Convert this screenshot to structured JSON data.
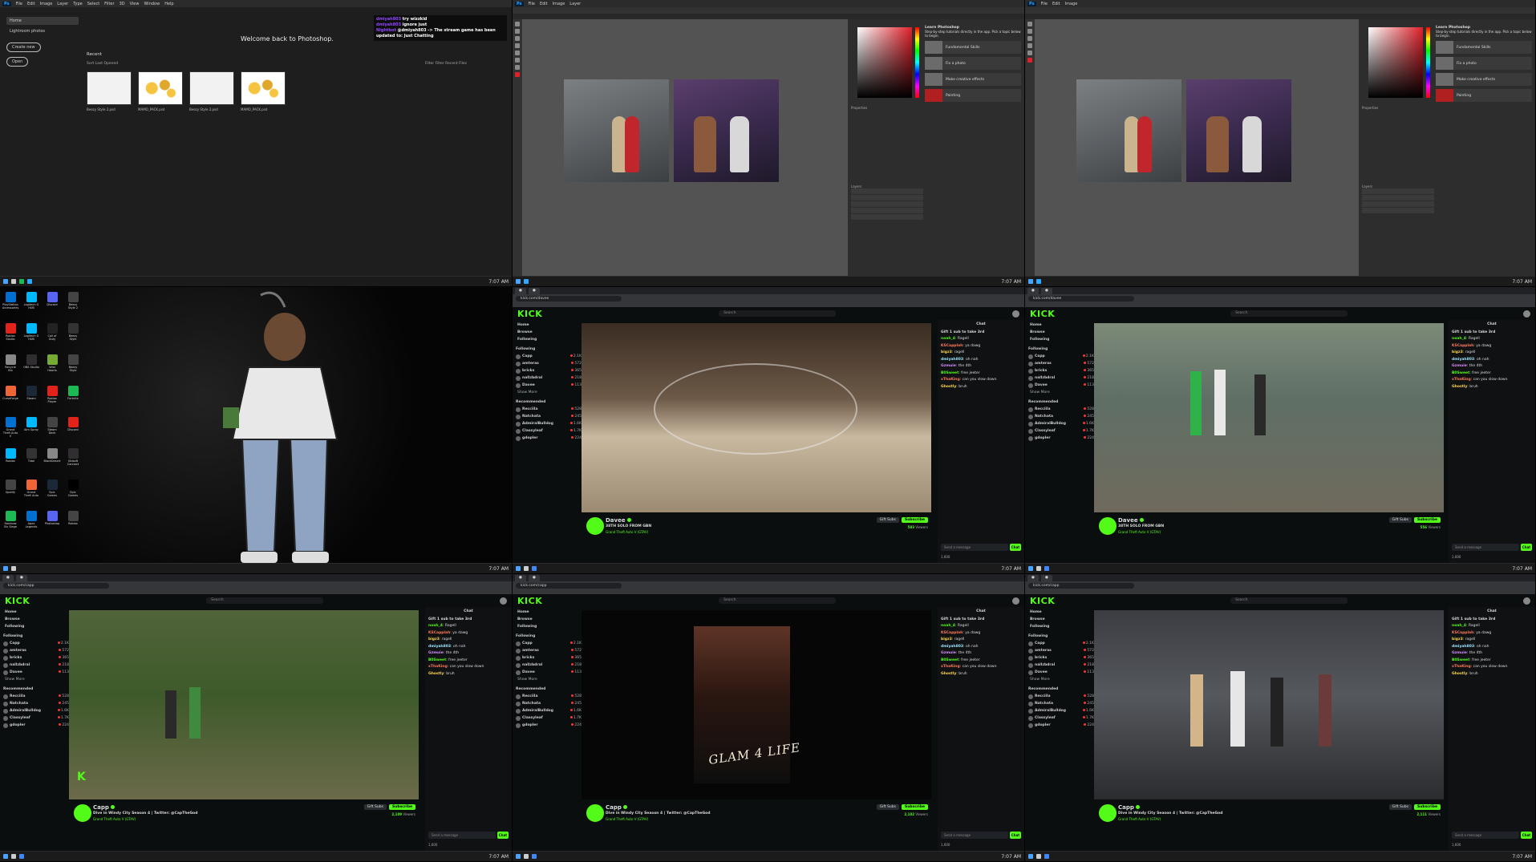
{
  "colors": {
    "kick_green": "#53fc18",
    "ps_blue": "#31a8ff",
    "twitch_purple": "#9147ff",
    "red_live": "#ff3333"
  },
  "taskbar": {
    "time": "7:07 AM"
  },
  "photoshop": {
    "app_short": "Ps",
    "menu": [
      "File",
      "Edit",
      "Image",
      "Layer",
      "Type",
      "Select",
      "Filter",
      "3D",
      "View",
      "Window",
      "Help"
    ],
    "home": {
      "nav": [
        "Home",
        "Lightroom photos"
      ],
      "create_new": "Create new",
      "open": "Open",
      "welcome": "Welcome back to Photoshop.",
      "recent": "Recent",
      "sort_label": "Sort",
      "sort_value": "Last Opened",
      "filter_label": "Filter",
      "filter_placeholder": "Filter Recent Files",
      "files": [
        {
          "name": "Beezy Style 2.psd",
          "style": "plain"
        },
        {
          "name": "MAMO_PACK.psd",
          "style": "coins"
        },
        {
          "name": "Beezy Style 2.psd",
          "style": "plain"
        },
        {
          "name": "MAMO_PACK.psd",
          "style": "coins"
        }
      ]
    },
    "editor": {
      "learn_title": "Learn Photoshop",
      "learn_sub": "Step-by-step tutorials directly in the app. Pick a topic below to begin.",
      "topics": [
        "Fundamental Skills",
        "Fix a photo",
        "Make creative effects",
        "Painting"
      ],
      "properties": "Properties",
      "layers": "Layers"
    }
  },
  "twitch_chat": [
    {
      "user": "dmiyah803",
      "text": "try wizzkid"
    },
    {
      "user": "dmiyah803",
      "text": "ignore just"
    },
    {
      "user": "Nightbot",
      "text": "@dmiyah803 -> The stream game has been updated to: Just Chatting"
    }
  ],
  "desktop": {
    "icons": [
      "PlayStation Accessories",
      "Logitech G HUB",
      "Discord",
      "Beezy Style 2",
      "Roblox Studio",
      "Logitech G HUB",
      "Call of Duty",
      "Beezy Style",
      "Recycle Bin",
      "OBS Studio",
      "Wild Hearts",
      "Beezy Style",
      "CurseForge",
      "Steam",
      "Roblox Player",
      "",
      "Fortnite",
      "Grand Theft Auto V",
      "Aim Spray",
      "",
      "Steam Deck",
      "Discord",
      "Roblox",
      "",
      "Tidal",
      "BlackDesert",
      "Ubisoft Connect",
      "",
      "Spotify",
      "Grand Theft Auto",
      "Epic Games",
      "",
      "Epic Games",
      "Rainbow Six Siege",
      "Apex Legends",
      "",
      "Photoshop",
      "Roblox",
      "",
      ""
    ]
  },
  "kick": {
    "logo": "KICK",
    "url": "kick.com/davee",
    "url2": "kick.com/capp",
    "search_placeholder": "Search",
    "nav": [
      "Home",
      "Browse",
      "Following"
    ],
    "following_header": "Following",
    "recommended_header": "Recommended",
    "show_more": "Show More",
    "following": [
      {
        "name": "Capp",
        "viewers": "2.1K"
      },
      {
        "name": "amteras",
        "viewers": "572"
      },
      {
        "name": "bricks",
        "viewers": "365"
      },
      {
        "name": "nallzbdral",
        "viewers": "218"
      },
      {
        "name": "Davee",
        "viewers": "113"
      }
    ],
    "recommended": [
      {
        "name": "Recciila",
        "viewers": "528"
      },
      {
        "name": "Natchata",
        "viewers": "245"
      },
      {
        "name": "AdmiralBulldog",
        "viewers": "1.6K"
      },
      {
        "name": "Classyleaf",
        "viewers": "1.7K"
      },
      {
        "name": "gdopler",
        "viewers": "224"
      }
    ],
    "chat_title": "Chat",
    "chat_pin": "Gift 1 sub to take 3rd",
    "chat_placeholder": "Send a message",
    "chat_button": "Chat",
    "chat_points": "1,600",
    "chat_messages": [
      {
        "user": "noah_4",
        "text": "Ragell"
      },
      {
        "user": "KSCapplah",
        "text": "ya dawg"
      },
      {
        "user": "bigz3",
        "text": "ragell"
      },
      {
        "user": "dmiyah803",
        "text": "oh nah"
      },
      {
        "user": "Gzmuie",
        "text": "the 4th"
      },
      {
        "user": "B0Sweet",
        "text": "free jeeter"
      },
      {
        "user": "xThaKing",
        "text": "can you slow down"
      },
      {
        "user": "Ghostly",
        "text": "bruh"
      }
    ],
    "streams": [
      {
        "streamer": "Davee",
        "title": "38TH SOLO FROM GBN",
        "category": "Grand Theft Auto V (GTAV)",
        "viewers": "583",
        "scene": "gta-basketball"
      },
      {
        "streamer": "Davee",
        "title": "38TH SOLO FROM GBN",
        "category": "Grand Theft Auto V (GTAV)",
        "viewers": "556",
        "scene": "gta-street"
      },
      {
        "streamer": "Capp",
        "title": "Dive in Windy City Season 4 | Twitter: @CapTheGod",
        "category": "Grand Theft Auto V (GTAV)",
        "viewers": "2,109",
        "scene": "gta-park"
      },
      {
        "streamer": "Capp",
        "title": "Dive in Windy City Season 4 | Twitter: @CapTheGod",
        "category": "Grand Theft Auto V (GTAV)",
        "viewers": "2,102",
        "scene": "glam"
      },
      {
        "streamer": "Capp",
        "title": "Dive in Windy City Season 4 | Twitter: @CapTheGod",
        "category": "Grand Theft Auto V (GTAV)",
        "viewers": "2,111",
        "scene": "gta-group"
      }
    ],
    "gift_subs": "Gift Subs",
    "subscribe": "Subscribe",
    "viewers_suffix": "Viewers",
    "glam_text": "GLAM 4 LIFE"
  }
}
